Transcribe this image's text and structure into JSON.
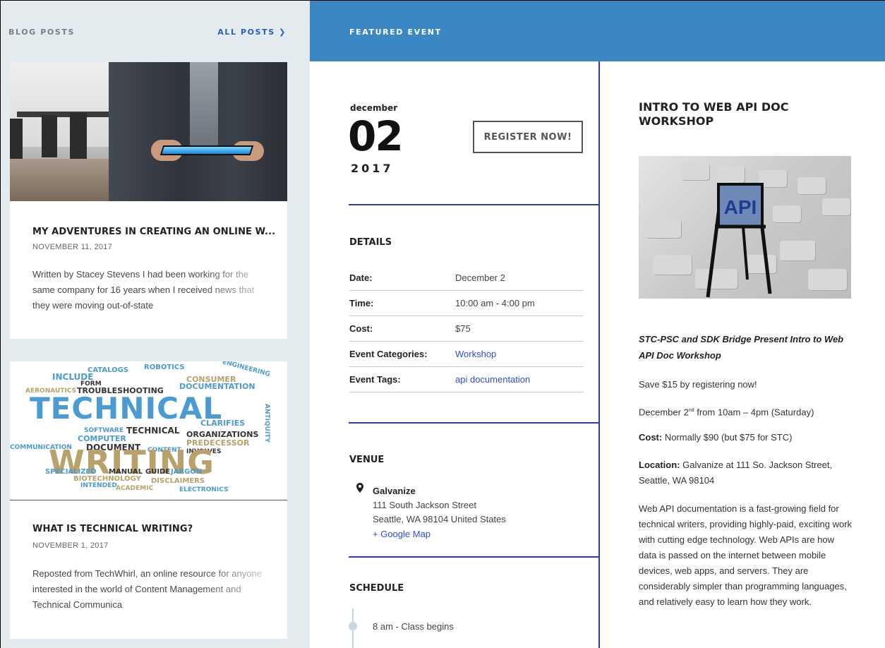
{
  "blog": {
    "heading": "BLOG POSTS",
    "all_posts": "ALL POSTS ❯",
    "posts": [
      {
        "title": "MY ADVENTURES IN CREATING AN ONLINE W...",
        "date": "NOVEMBER 11, 2017",
        "excerpt": "Written by Stacey Stevens I had been working for the same company for 16 years when I received news that they were moving out-of-state"
      },
      {
        "title": "WHAT IS TECHNICAL WRITING?",
        "date": "NOVEMBER 1, 2017",
        "excerpt": "Reposted from TechWhirl, an online resource for anyone interested in the world of Content Management and Technical Communica"
      }
    ],
    "cloud_words": {
      "technical": "TECHNICAL",
      "writing": "WRITING",
      "include": "INCLUDE",
      "troubleshooting": "TROUBLESHOOTING",
      "aeronautics": "AERONAUTICS",
      "communication": "COMMUNICATION",
      "document": "DOCUMENT",
      "documentation": "DOCUMENTATION",
      "specialized": "SPECIALIZED",
      "manual": "MANUAL",
      "guide": "GUIDE",
      "jargon": "JARGON",
      "clarifies": "CLARIFIES",
      "organizations": "ORGANIZATIONS",
      "predecessor": "PREDECESSOR",
      "catalogs": "CATALOGS",
      "robotics": "ROBOTICS",
      "engineering": "ENGINEERING",
      "antiquity": "ANTIQUITY",
      "software": "SOFTWARE",
      "computer": "COMPUTER",
      "biotechnology": "BIOTECHNOLOGY",
      "disclaimers": "DISCLAIMERS",
      "intended": "INTENDED",
      "form": "FORM",
      "consumer": "CONSUMER",
      "content": "CONTENT",
      "involves": "INVOLVES",
      "academic": "ACADEMIC",
      "electronics": "ELECTRONICS"
    }
  },
  "event": {
    "section_label": "FEATURED EVENT",
    "month": "december",
    "day": "02",
    "year": "2017",
    "register_label": "REGISTER NOW!",
    "details_heading": "DETAILS",
    "details": [
      {
        "label": "Date:",
        "value": "December 2"
      },
      {
        "label": "Time:",
        "value": "10:00 am - 4:00 pm"
      },
      {
        "label": "Cost:",
        "value": "$75"
      },
      {
        "label": "Event Categories:",
        "value": "Workshop"
      },
      {
        "label": "Event Tags:",
        "value": "api documentation"
      }
    ],
    "venue_heading": "VENUE",
    "venue": {
      "name": "Galvanize",
      "street": "111 South Jackson Street",
      "city": "Seattle, WA 98104 United States",
      "map_link": "+ Google Map"
    },
    "schedule_heading": "SCHEDULE",
    "schedule": [
      {
        "text": "8 am - Class begins"
      }
    ],
    "title": "INTRO TO WEB API DOC WORKSHOP",
    "image_text": "API",
    "subtitle": "STC-PSC and SDK Bridge Present Intro to Web API Doc Workshop",
    "save": "Save $15 by registering now!",
    "when_prefix": "December 2",
    "when_sup": "nd",
    "when_suffix": " from 10am – 4pm (Saturday)",
    "cost_label": "Cost:",
    "cost_text": " Normally $90 (but $75 for STC)",
    "location_label": "Location:",
    "location_text": " Galvanize at 111 So. Jackson Street, Seattle, WA 98104",
    "description": "Web API documentation is a fast-growing field for technical writers, providing highly-paid, exciting work with cutting edge technology. Web APIs are how data is passed on the internet between mobile devices, web apps, and servers. They are considerably simpler than programming languages, and relatively easy to learn how they work."
  },
  "colors": {
    "feature_bar": "#3a87c4",
    "divider": "#2e3cad",
    "link": "#2a4fd6",
    "blog_bg": "#e3ebee"
  }
}
